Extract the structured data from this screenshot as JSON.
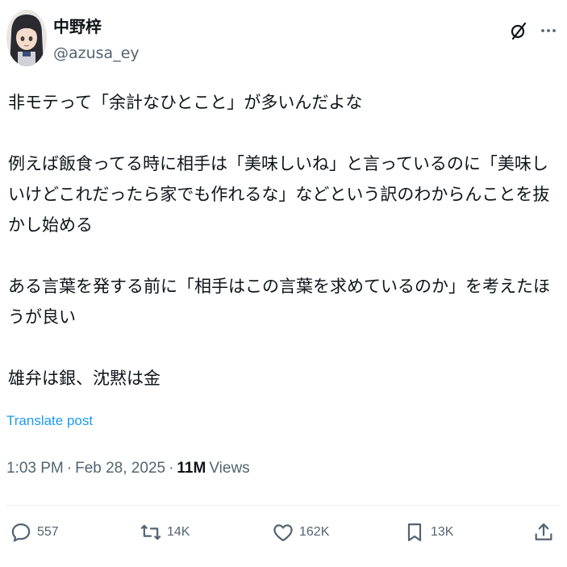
{
  "author": {
    "display_name": "中野梓",
    "handle": "@azusa_ey"
  },
  "header": {
    "icons": [
      "grok-icon",
      "more-icon"
    ]
  },
  "tweet": {
    "paragraphs": [
      "非モテって「余計なひとこと」が多いんだよな",
      "例えば飯食ってる時に相手は「美味しいね」と言っているのに「美味しいけどこれだったら家でも作れるな」などという訳のわからんことを抜かし始める",
      "ある言葉を発する前に「相手はこの言葉を求めているのか」を考えたほうが良い",
      "雄弁は銀、沈黙は金"
    ],
    "translate_label": "Translate post"
  },
  "meta": {
    "time": "1:03 PM",
    "separator": "·",
    "date": "Feb 28, 2025",
    "views_count": "11M",
    "views_label": "Views"
  },
  "actions": {
    "reply": {
      "icon": "reply-icon",
      "count": "557"
    },
    "retweet": {
      "icon": "retweet-icon",
      "count": "14K"
    },
    "like": {
      "icon": "heart-icon",
      "count": "162K"
    },
    "bookmark": {
      "icon": "bookmark-icon",
      "count": "13K"
    },
    "share": {
      "icon": "share-icon"
    }
  },
  "colors": {
    "text": "#0f1419",
    "secondary": "#536471",
    "link": "#1d9bf0",
    "divider": "#eff3f4"
  }
}
